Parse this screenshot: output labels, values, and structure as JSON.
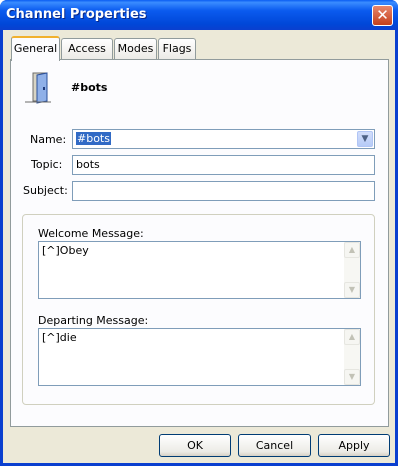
{
  "window": {
    "title": "Channel Properties",
    "close_label": "✕"
  },
  "tabs": [
    {
      "label": "General",
      "active": true
    },
    {
      "label": "Access"
    },
    {
      "label": "Modes"
    },
    {
      "label": "Flags"
    }
  ],
  "channel": {
    "name": "#bots"
  },
  "form": {
    "name_label": "Name:",
    "name_value": "#bots",
    "topic_label": "Topic:",
    "topic_value": "bots",
    "subject_label": "Subject:",
    "subject_value": ""
  },
  "welcome": {
    "label": "Welcome Message:",
    "value": "[^]Obey"
  },
  "departing": {
    "label": "Departing Message:",
    "value": "[^]die"
  },
  "buttons": {
    "ok": "OK",
    "cancel": "Cancel",
    "apply": "Apply"
  },
  "icons": {
    "channel": "door-icon",
    "close": "close-icon",
    "dropdown": "chevron-down-icon"
  }
}
